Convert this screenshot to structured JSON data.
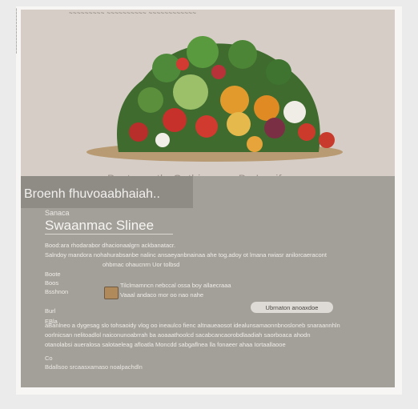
{
  "header": {
    "top_strip_text": "~~~~~~~~~ ~~~~~~~~~~ ~~~~~~~~~~~~"
  },
  "side_label": "~~~~~~~~~~~~~~",
  "hero": {
    "caption": "Br.storng thaGatbiy moo: Ba.Irnaifn"
  },
  "panel": {
    "title": "Broenh fhuvoaabhaiah..",
    "tag": "Sanaca",
    "subtitle": "Swaanmac Slinee",
    "lines1": [
      "Bood:ara rhodarabor dhacionaalgrn ackbanatacr.",
      "Salndoy mandora nohahurabsanbe nalinc ansaeyanbnainaa ahe tog.adoy ot lmana rwiasr anilorcaeracont",
      "ohbmac ohaucnrn Uor tolbsd"
    ],
    "block2_labels": [
      "Boote",
      "Boos",
      "Bsshnon",
      "Burl"
    ],
    "block2_lines": [
      "Tilclmamncn nebccal ossa boy allaecraaa",
      "Vaaal andaco mor oo nao nahe"
    ],
    "pill_button": "Ubrnaton anoaxdoe",
    "para2_heading": "EBla",
    "para2_lines": [
      "aBanlneo a dygesag slo tohsaoidy vlog oo ineaulco fienc altnaueaosot idealunsamaonnbnosloneb snaraannhln",
      "oorlnicsan nelitoadlol naiconunoabrrah ba aoaaathoolcd sacabcancaorobdlaadiah saorboaca ahodn",
      "otanolabsi aueralosa salotaeleag afloatla Moncdd sabgaflnea lla fonaeer ahaa Iortaallaooe"
    ],
    "footer_small": "Co",
    "footer_line": "Bdallsoo srcaasxamaso noalpachdln"
  }
}
